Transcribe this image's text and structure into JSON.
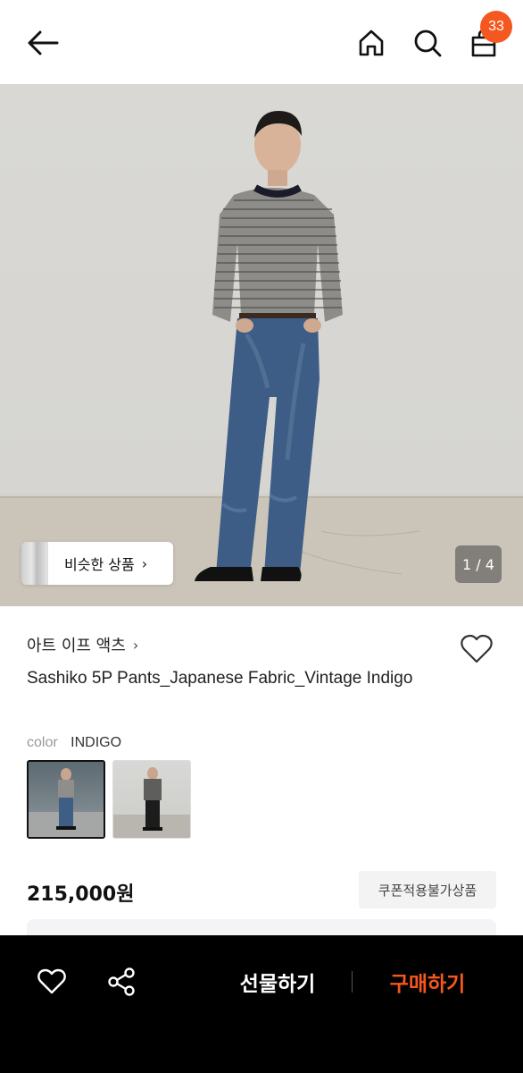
{
  "header": {
    "back_icon": "arrow-left-icon",
    "home_icon": "home-icon",
    "search_icon": "search-icon",
    "bag_icon": "shopping-bag-icon",
    "cart_count": "33",
    "badge_color": "#f4571f"
  },
  "hero": {
    "similar_products_label": "비슷한 상품",
    "similar_chevron": "›",
    "pager": "1 / 4"
  },
  "product": {
    "brand": "아트 이프 액츠",
    "brand_chevron": "›",
    "title": "Sashiko 5P Pants_Japanese Fabric_Vintage Indigo",
    "color_label": "color",
    "color_value": "INDIGO",
    "price": "215,000원",
    "coupon_tag": "쿠폰적용불가상품",
    "wish_icon": "heart-outline-icon"
  },
  "bottom_bar": {
    "like_icon": "heart-outline-icon",
    "share_icon": "share-icon",
    "gift_label": "선물하기",
    "buy_label": "구매하기",
    "buy_color": "#f4571f"
  }
}
